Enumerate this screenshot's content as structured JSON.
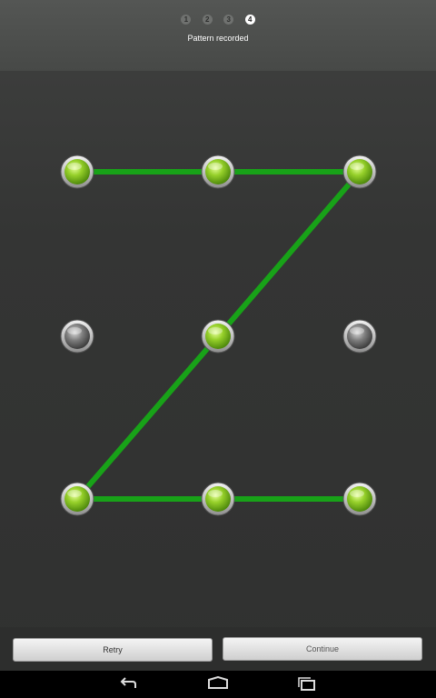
{
  "header": {
    "steps": [
      "1",
      "2",
      "3",
      "4"
    ],
    "active_step": 4,
    "status_text": "Pattern recorded"
  },
  "pattern": {
    "grid_size": 3,
    "selected_sequence": [
      1,
      2,
      3,
      5,
      7,
      8,
      9
    ],
    "dots": [
      {
        "index": 1,
        "selected": true
      },
      {
        "index": 2,
        "selected": true
      },
      {
        "index": 3,
        "selected": true
      },
      {
        "index": 4,
        "selected": false
      },
      {
        "index": 5,
        "selected": true
      },
      {
        "index": 6,
        "selected": false
      },
      {
        "index": 7,
        "selected": true
      },
      {
        "index": 8,
        "selected": true
      },
      {
        "index": 9,
        "selected": true
      }
    ],
    "colors": {
      "line": "#18a218",
      "selected": "#96d02a",
      "unselected": "#8a8a8a"
    }
  },
  "buttons": {
    "retry_label": "Retry",
    "continue_label": "Continue"
  },
  "navbar": {
    "icons": [
      "back-icon",
      "home-icon",
      "recent-apps-icon"
    ]
  }
}
